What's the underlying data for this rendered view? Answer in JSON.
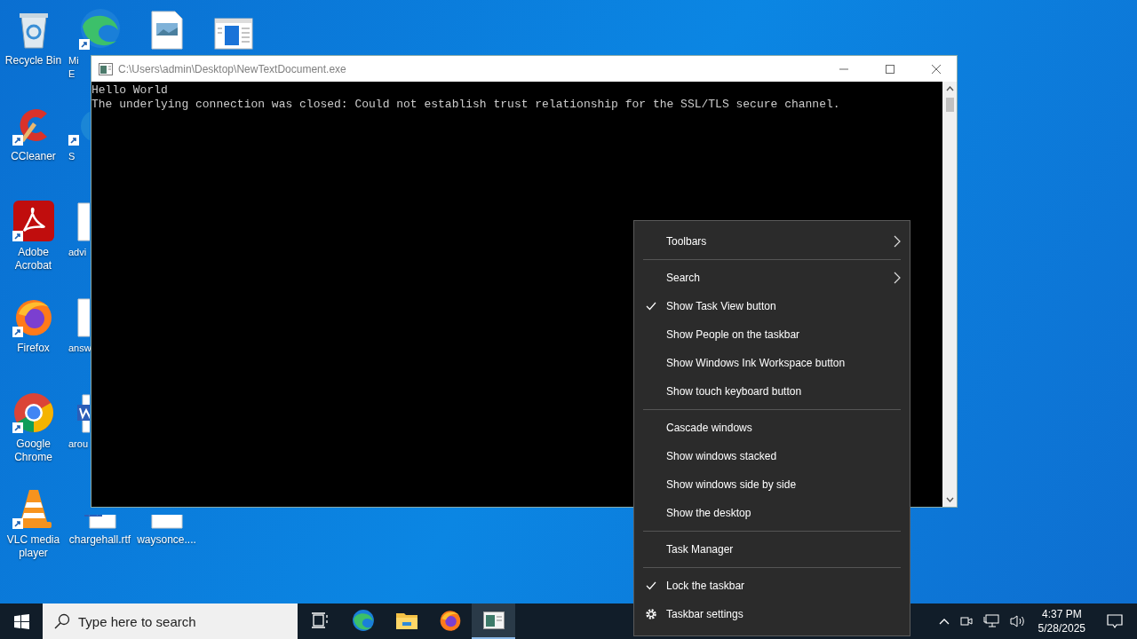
{
  "desktop": {
    "columns": [
      [
        {
          "kind": "recycle-bin",
          "label": "Recycle Bin",
          "shortcut": false,
          "clipped": false,
          "icon_covered": false
        },
        {
          "kind": "ccleaner",
          "label": "CCleaner",
          "shortcut": true,
          "clipped": false,
          "icon_covered": false
        },
        {
          "kind": "pdf",
          "label": "Adobe Acrobat",
          "shortcut": true,
          "clipped": false,
          "icon_covered": false
        },
        {
          "kind": "firefox",
          "label": "Firefox",
          "shortcut": true,
          "clipped": false,
          "icon_covered": false
        },
        {
          "kind": "chrome",
          "label": "Google Chrome",
          "shortcut": true,
          "clipped": false,
          "icon_covered": false
        },
        {
          "kind": "vlc",
          "label": "VLC media player",
          "shortcut": true,
          "clipped": false,
          "icon_covered": false
        }
      ],
      [
        {
          "kind": "edge",
          "label": "Mi\nE",
          "shortcut": true,
          "clipped": true,
          "icon_covered": false
        },
        {
          "kind": "generic",
          "label": "S",
          "shortcut": true,
          "clipped": true,
          "icon_covered": true
        },
        {
          "kind": "document",
          "label": "advi",
          "shortcut": false,
          "clipped": true,
          "icon_covered": true
        },
        {
          "kind": "document",
          "label": "answ",
          "shortcut": false,
          "clipped": true,
          "icon_covered": true
        },
        {
          "kind": "word-doc",
          "label": "arou",
          "shortcut": false,
          "clipped": true,
          "icon_covered": true
        },
        {
          "kind": "word-doc",
          "label": "chargehall.rtf",
          "shortcut": false,
          "clipped": false,
          "icon_covered": true
        }
      ],
      [
        {
          "kind": "image-file",
          "shortcut": false,
          "clipped": false,
          "icon_covered": false
        },
        {
          "kind": "none"
        },
        {
          "kind": "none"
        },
        {
          "kind": "none"
        },
        {
          "kind": "none"
        },
        {
          "kind": "image-file",
          "label": "waysonce....",
          "shortcut": false,
          "clipped": false,
          "icon_covered": true
        }
      ],
      [
        {
          "kind": "app-window",
          "shortcut": false,
          "clipped": false,
          "icon_covered": false
        }
      ]
    ]
  },
  "console_window": {
    "title": "C:\\Users\\admin\\Desktop\\NewTextDocument.exe",
    "lines": [
      "Hello World",
      "The underlying connection was closed: Could not establish trust relationship for the SSL/TLS secure channel."
    ]
  },
  "context_menu": {
    "items": [
      {
        "kind": "submenu",
        "label": "Toolbars",
        "checked": false
      },
      {
        "kind": "separator"
      },
      {
        "kind": "submenu",
        "label": "Search",
        "checked": false
      },
      {
        "kind": "item",
        "label": "Show Task View button",
        "checked": true
      },
      {
        "kind": "item",
        "label": "Show People on the taskbar",
        "checked": false
      },
      {
        "kind": "item",
        "label": "Show Windows Ink Workspace button",
        "checked": false
      },
      {
        "kind": "item",
        "label": "Show touch keyboard button",
        "checked": false
      },
      {
        "kind": "separator"
      },
      {
        "kind": "item",
        "label": "Cascade windows",
        "checked": false
      },
      {
        "kind": "item",
        "label": "Show windows stacked",
        "checked": false
      },
      {
        "kind": "item",
        "label": "Show windows side by side",
        "checked": false
      },
      {
        "kind": "item",
        "label": "Show the desktop",
        "checked": false
      },
      {
        "kind": "separator"
      },
      {
        "kind": "item",
        "label": "Task Manager",
        "checked": false
      },
      {
        "kind": "separator"
      },
      {
        "kind": "item",
        "label": "Lock the taskbar",
        "checked": true
      },
      {
        "kind": "setting",
        "label": "Taskbar settings",
        "checked": false
      }
    ]
  },
  "taskbar": {
    "search": {
      "placeholder": "Type here to search"
    },
    "apps": [
      {
        "kind": "task-view",
        "selected": false
      },
      {
        "kind": "edge",
        "selected": false
      },
      {
        "kind": "folder",
        "selected": false
      },
      {
        "kind": "firefox",
        "selected": false
      },
      {
        "kind": "console",
        "selected": true
      }
    ],
    "clock": {
      "time": "4:37 PM",
      "date": "5/28/2025"
    }
  }
}
